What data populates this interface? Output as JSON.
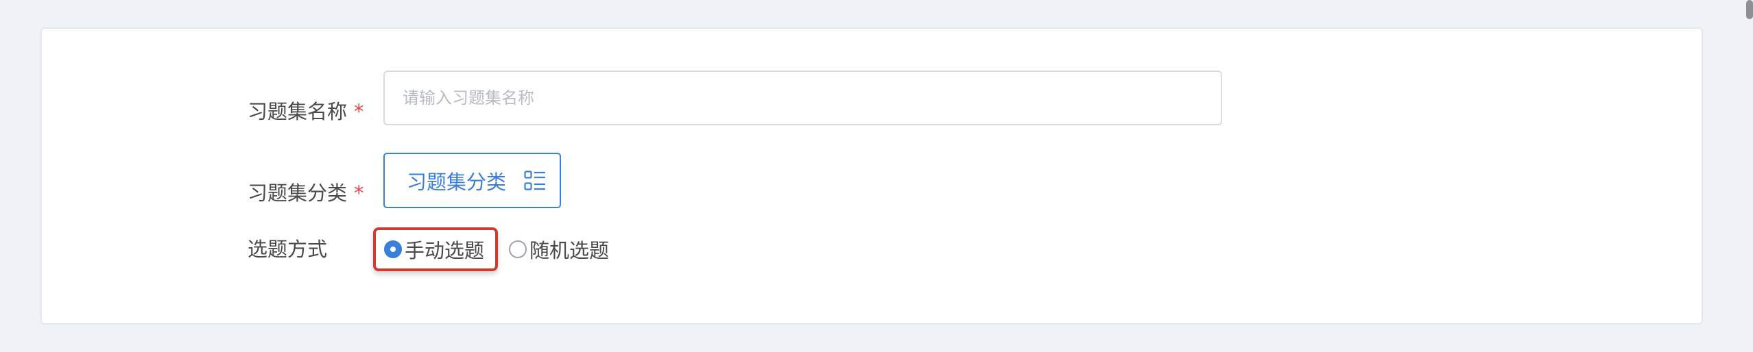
{
  "form": {
    "name": {
      "label": "习题集名称",
      "required_mark": "*",
      "placeholder": "请输入习题集名称",
      "value": ""
    },
    "category": {
      "label": "习题集分类",
      "required_mark": "*",
      "button_label": "习题集分类",
      "icon": "list-grid-icon"
    },
    "selection_mode": {
      "label": "选题方式",
      "options": [
        {
          "label": "手动选题",
          "selected": true
        },
        {
          "label": "随机选题",
          "selected": false
        }
      ]
    }
  },
  "colors": {
    "accent": "#3a7fd9",
    "required": "#e34848",
    "highlight_border": "#d33a2c",
    "page_background": "#eff2f7"
  }
}
